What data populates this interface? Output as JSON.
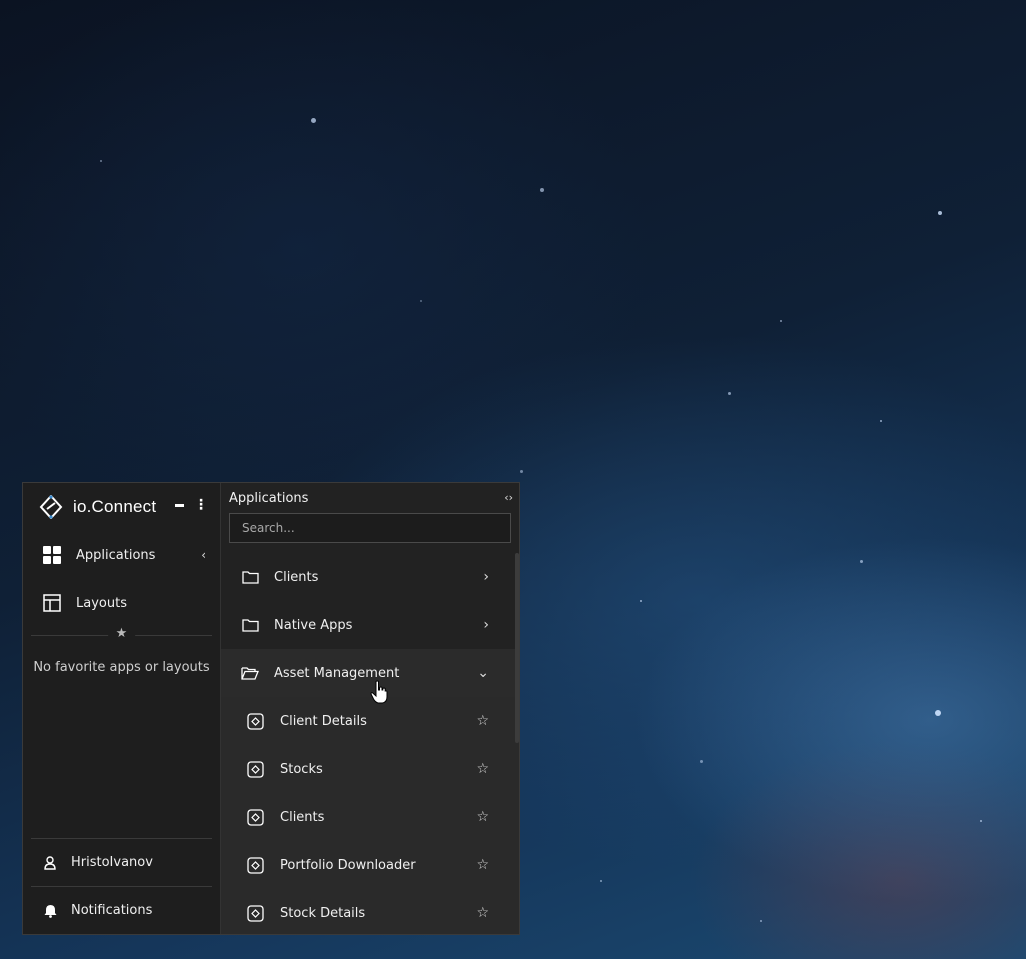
{
  "brand": {
    "name": "io.Connect"
  },
  "sidebar": {
    "nav": [
      {
        "label": "Applications",
        "icon": "grid-icon",
        "active": true
      },
      {
        "label": "Layouts",
        "icon": "layout-icon"
      }
    ],
    "favorites_empty": "No favorite apps or layouts",
    "user": {
      "label": "HristoIvanov",
      "icon": "user-icon"
    },
    "notifications": {
      "label": "Notifications",
      "icon": "bell-icon"
    }
  },
  "panel": {
    "title": "Applications",
    "search_placeholder": "Search...",
    "folders": [
      {
        "label": "Clients",
        "state": "collapsed"
      },
      {
        "label": "Native Apps",
        "state": "collapsed"
      },
      {
        "label": "Asset Management",
        "state": "expanded"
      }
    ],
    "apps": [
      {
        "label": "Client Details"
      },
      {
        "label": "Stocks"
      },
      {
        "label": "Clients"
      },
      {
        "label": "Portfolio Downloader"
      },
      {
        "label": "Stock Details"
      }
    ]
  },
  "colors": {
    "window_bg": "#1e1e1e",
    "panel_bg": "#222222",
    "accent": "#3f8fd2"
  }
}
